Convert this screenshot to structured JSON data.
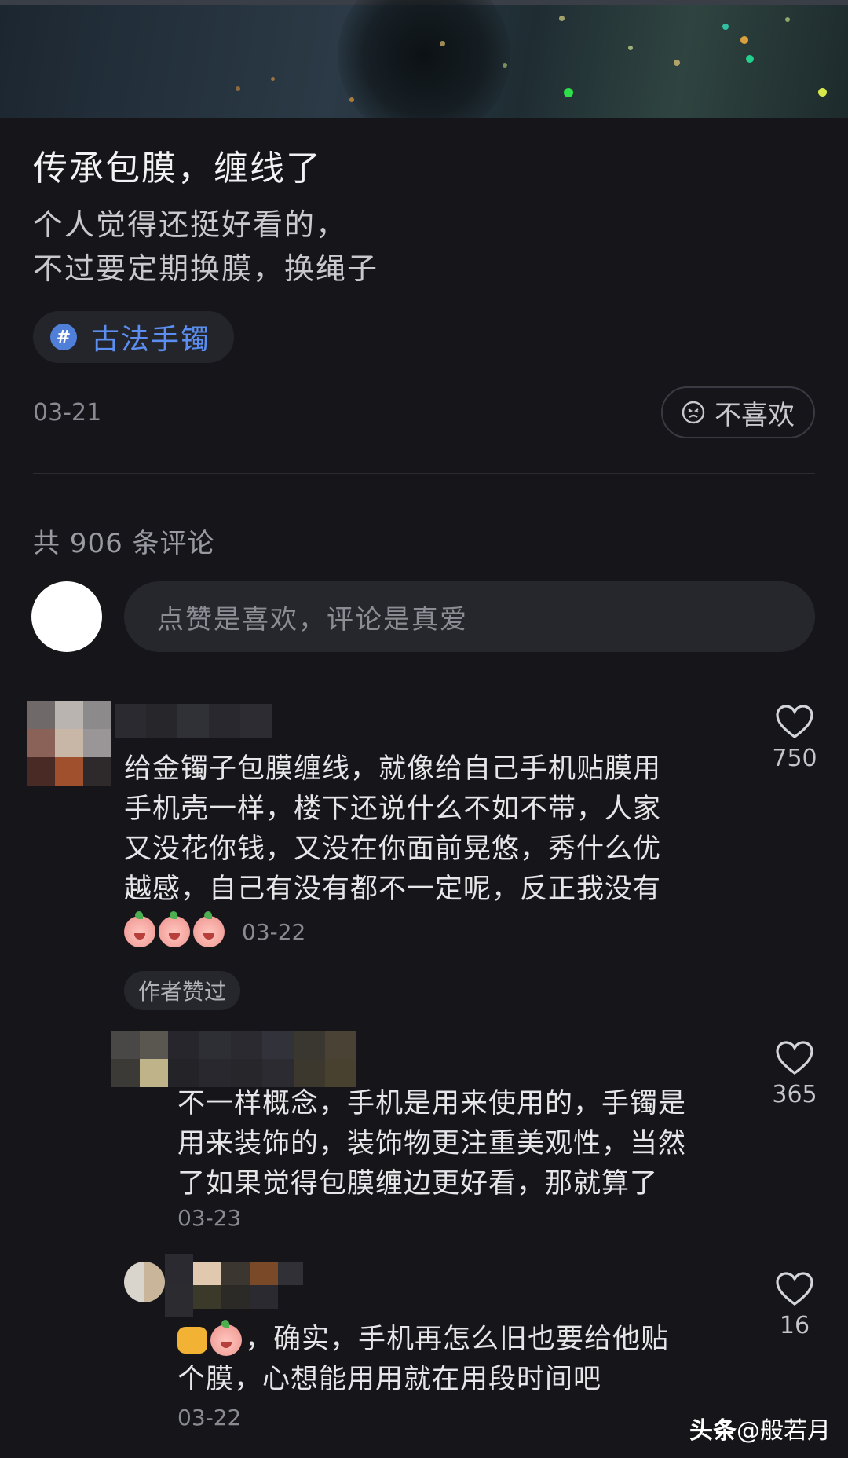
{
  "post": {
    "title": "传承包膜，缠线了",
    "body_lines": [
      "个人觉得还挺好看的，",
      "不过要定期换膜，换绳子"
    ],
    "tag": {
      "icon": "#",
      "label": "古法手镯"
    },
    "date": "03-21",
    "dislike_label": "不喜欢"
  },
  "comments_header": {
    "count_text": "共 906 条评论"
  },
  "comment_input": {
    "placeholder": "点赞是喜欢，评论是真爱"
  },
  "comments": [
    {
      "lines": [
        "给金镯子包膜缠线，就像给自己手机贴膜用",
        "手机壳一样，楼下还说什么不如不带，人家",
        "又没花你钱，又没在你面前晃悠，秀什么优",
        "越感，自己有没有都不一定呢，反正我没有"
      ],
      "emoji_count": 3,
      "date": "03-22",
      "likes": "750",
      "author_badge": "作者赞过"
    },
    {
      "lines": [
        "不一样概念，手机是用来使用的，手镯是",
        "用来装饰的，装饰物更注重美观性，当然",
        "了如果觉得包膜缠边更好看，那就算了"
      ],
      "date": "03-23",
      "likes": "365"
    },
    {
      "first_line_text": "，确实，手机再怎么旧也要给他贴",
      "second_line": "个膜，心想能用用就在用段时间吧",
      "date": "03-22",
      "likes": "16"
    }
  ],
  "watermark": {
    "brand": "头条",
    "handle": "@般若月"
  },
  "colors": {
    "background": "#16161a",
    "accent_blue": "#5b8ef0",
    "text_primary": "#e6e6e9",
    "text_muted": "#8a8b92"
  }
}
